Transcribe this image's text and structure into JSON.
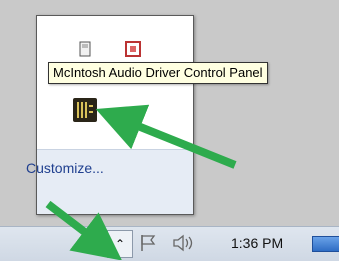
{
  "tray_flyout": {
    "customize_label": "Customize...",
    "icons": [
      "usb-device-icon",
      "app-icon",
      "mcintosh-audio-icon"
    ]
  },
  "tooltip": {
    "text": "McIntosh Audio Driver Control Panel"
  },
  "taskbar": {
    "overflow_icon": "chevron-up-icon",
    "action_center_icon": "flag-icon",
    "volume_icon": "speaker-icon",
    "clock": "1:36 PM"
  },
  "annotations": {
    "arrow_color": "#2eab4d"
  },
  "colors": {
    "tooltip_bg": "#ffffe1",
    "link": "#1f3f8f",
    "taskbar": "#d8e0ea"
  }
}
